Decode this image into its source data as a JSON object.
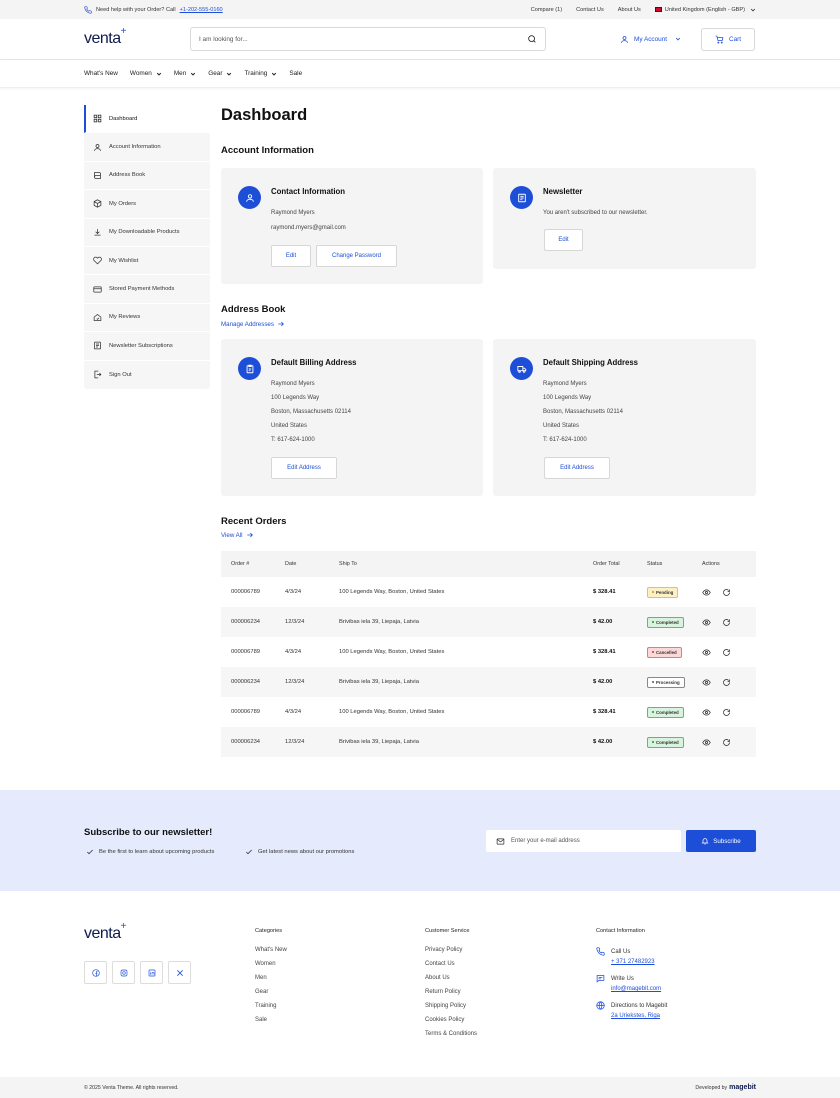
{
  "topbar": {
    "help_text": "Need help with your Order? Call",
    "phone": "+1-202-555-0160",
    "compare": "Compare (1)",
    "contact": "Contact Us",
    "about": "About Us",
    "locale": "United Kingdom (English - GBP)"
  },
  "header": {
    "logo": "venta",
    "search_placeholder": "I am looking for...",
    "account": "My Account",
    "cart": "Cart"
  },
  "nav": [
    "What's New",
    "Women",
    "Men",
    "Gear",
    "Training",
    "Sale"
  ],
  "sidebar": [
    {
      "label": "Dashboard",
      "icon": "grid-icon"
    },
    {
      "label": "Account Information",
      "icon": "user-icon"
    },
    {
      "label": "Address Book",
      "icon": "book-icon"
    },
    {
      "label": "My Orders",
      "icon": "box-icon"
    },
    {
      "label": "My Downloadable Products",
      "icon": "download-icon"
    },
    {
      "label": "My Wishlist",
      "icon": "heart-icon"
    },
    {
      "label": "Stored Payment Methods",
      "icon": "card-icon"
    },
    {
      "label": "My Reviews",
      "icon": "review-icon"
    },
    {
      "label": "Newsletter Subscriptions",
      "icon": "newsletter-icon"
    },
    {
      "label": "Sign Out",
      "icon": "signout-icon"
    }
  ],
  "main": {
    "title": "Dashboard",
    "account_info": "Account Information",
    "contact": {
      "title": "Contact Information",
      "name": "Raymond Myers",
      "email": "raymond.myers@gmail.com",
      "edit": "Edit",
      "change_password": "Change Password"
    },
    "newsletter": {
      "title": "Newsletter",
      "text": "You aren't subscribed to our newsletter.",
      "edit": "Edit"
    },
    "address_book": "Address Book",
    "manage_addresses": "Manage Addresses",
    "billing": {
      "title": "Default Billing Address",
      "lines": [
        "Raymond Myers",
        "100 Legends Way",
        "Boston, Massachusetts 02114",
        "United States",
        "T: 617-624-1000"
      ],
      "edit": "Edit Address"
    },
    "shipping": {
      "title": "Default Shipping Address",
      "lines": [
        "Raymond Myers",
        "100 Legends Way",
        "Boston, Massachusetts 02114",
        "United States",
        "T: 617-624-1000"
      ],
      "edit": "Edit Address"
    },
    "recent_orders": "Recent Orders",
    "view_all": "View All"
  },
  "orders": {
    "columns": [
      "Order #",
      "Date",
      "Ship To",
      "Order Total",
      "Status",
      "Actions"
    ],
    "rows": [
      {
        "order": "000006789",
        "date": "4/3/24",
        "ship": "100 Legends Way, Boston, United States",
        "total": "$ 328.41",
        "status": "Pending"
      },
      {
        "order": "000006234",
        "date": "12/3/24",
        "ship": "Brivibas iela 39, Liepaja, Latvia",
        "total": "$ 42.00",
        "status": "Completed"
      },
      {
        "order": "000006789",
        "date": "4/3/24",
        "ship": "100 Legends Way, Boston, United States",
        "total": "$ 328.41",
        "status": "Cancelled"
      },
      {
        "order": "000006234",
        "date": "12/3/24",
        "ship": "Brivibas iela 39, Liepaja, Latvia",
        "total": "$ 42.00",
        "status": "Processing"
      },
      {
        "order": "000006789",
        "date": "4/3/24",
        "ship": "100 Legends Way, Boston, United States",
        "total": "$ 328.41",
        "status": "Completed"
      },
      {
        "order": "000006234",
        "date": "12/3/24",
        "ship": "Brivibas iela 39, Liepaja, Latvia",
        "total": "$ 42.00",
        "status": "Completed"
      }
    ]
  },
  "status_colors": {
    "Pending": {
      "bg": "#fdf0c4",
      "border": "#e3c25a",
      "dot": "#c8951a"
    },
    "Completed": {
      "bg": "#d8f3de",
      "border": "#5cb978",
      "dot": "#238a45"
    },
    "Cancelled": {
      "bg": "#fbd9d9",
      "border": "#e07b7b",
      "dot": "#c0392b"
    },
    "Processing": {
      "bg": "#ffffff",
      "border": "#888888",
      "dot": "#555555"
    }
  },
  "newsletter_band": {
    "title": "Subscribe to our newsletter!",
    "feature1": "Be the first to learn about upcoming products",
    "feature2": "Get latest news about our promotions",
    "email_placeholder": "Enter your e-mail address",
    "subscribe": "Subscribe"
  },
  "footer": {
    "logo": "venta",
    "categories_title": "Categories",
    "categories": [
      "What's New",
      "Women",
      "Men",
      "Gear",
      "Training",
      "Sale"
    ],
    "service_title": "Customer Service",
    "service": [
      "Privacy Policy",
      "Contact Us",
      "About Us",
      "Return Policy",
      "Shipping Policy",
      "Cookies Policy",
      "Terms & Conditions"
    ],
    "contact_title": "Contact Information",
    "call_label": "Call Us",
    "call_value": "+ 371 27482923",
    "write_label": "Write Us",
    "write_value": "info@magebit.com",
    "directions_label": "Directions to Magebit",
    "directions_value": "2a Uriekstes, Riga",
    "copyright": "© 2025 Venta Theme. All rights reserved.",
    "developed_by": "Developed by",
    "developer": "magebit"
  },
  "colors": {
    "accent": "#1d4ed8",
    "card_bg": "#f4f4f5",
    "band_bg": "#e5ebfc"
  }
}
